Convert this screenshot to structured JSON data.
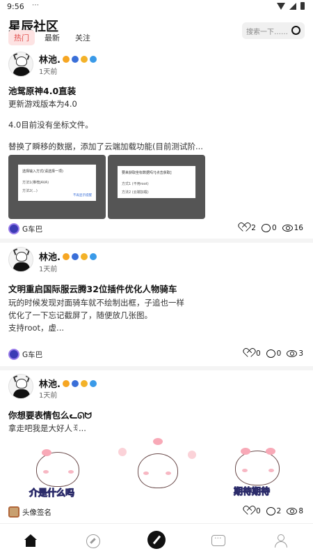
{
  "statusbar": {
    "time": "9:56",
    "indicators": "⋯"
  },
  "header": {
    "title": "星辰社区",
    "tabs": [
      {
        "label": "热门",
        "active": true
      },
      {
        "label": "最新",
        "active": false
      },
      {
        "label": "关注",
        "active": false
      }
    ],
    "search_placeholder": "搜索一下……"
  },
  "posts": [
    {
      "author": "林池.",
      "time": "1天前",
      "title": "池鸳原神4.0直装",
      "lines": [
        "更新游戏版本为4.0",
        "4.0目前没有坐标文件。",
        "替换了瞬移的数据，添加了云端加载功能(目前测试阶..."
      ],
      "images": [
        {
          "dialog_title": "选择输入方式(请选择一项)",
          "option1": "方法1(推荐JAVA)",
          "option2": "方法2(...)",
          "button": "不再显示提醒"
        },
        {
          "dialog_title": "要来获取坐标数据吗?[点击获取]",
          "option1": "方式1 (不用root)",
          "option2": "方法2 (云端加载)",
          "button": ""
        }
      ],
      "circle": "G车巴",
      "likes": "2",
      "comments": "0",
      "views": "16"
    },
    {
      "author": "林池.",
      "time": "1天前",
      "title": "文明重启国际服云腾32位插件优化人物骑车",
      "lines": [
        "玩的时候发现对面骑车就不绘制出框，子追也一样",
        "优化了一下忘记截屏了，随便放几张图。",
        "支持root，虚..."
      ],
      "circle": "G车巴",
      "likes": "0",
      "comments": "0",
      "views": "3"
    },
    {
      "author": "林池.",
      "time": "1天前",
      "title": "你想要表情包么ᓚᘏᗢ",
      "lines": [
        "拿走吧我是大好人ꉂ..."
      ],
      "stickers": [
        "介是什么吗",
        "期待期待"
      ],
      "circle": "头像签名",
      "likes": "0",
      "comments": "2",
      "views": "8"
    }
  ]
}
